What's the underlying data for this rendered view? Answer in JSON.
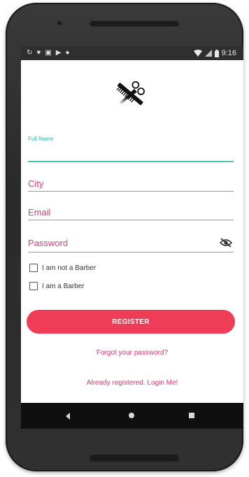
{
  "statusbar": {
    "time": "9:16",
    "icons_left": [
      "sync-icon",
      "heart-icon",
      "gallery-icon",
      "play-icon",
      "circle-icon"
    ],
    "icons_right": [
      "wifi-icon",
      "signal-icon",
      "battery-icon"
    ]
  },
  "logo": {
    "icon": "scissors-comb-icon"
  },
  "form": {
    "full_name": {
      "label": "Full Name",
      "value": ""
    },
    "city": {
      "placeholder": "City"
    },
    "email": {
      "placeholder": "Email"
    },
    "password": {
      "placeholder": "Password",
      "toggle_icon": "eye-off-icon"
    },
    "checkboxes": [
      {
        "label": "I am not a Barber",
        "checked": false
      },
      {
        "label": "I am a Barber",
        "checked": false
      }
    ]
  },
  "actions": {
    "register_label": "REGISTER",
    "forgot_label": "Forgot your password?",
    "login_label": "Already registered. Login Me!"
  },
  "colors": {
    "accent": "#ef3d57",
    "field_active": "#4cc3b1",
    "hint_text": "#d6407a",
    "link_text": "#e0356b"
  },
  "navigation": {
    "buttons": [
      "back",
      "home",
      "recents"
    ]
  }
}
